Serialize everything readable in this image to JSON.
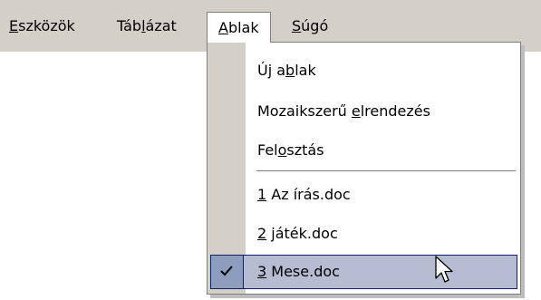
{
  "menubar": {
    "items": [
      {
        "mnemonic": "E",
        "rest": "szközök"
      },
      {
        "pre": "Táb",
        "mnemonic": "l",
        "rest": "ázat"
      },
      {
        "mnemonic": "A",
        "rest": "blak"
      },
      {
        "mnemonic": "S",
        "rest": "úgó"
      }
    ],
    "open_index": 2
  },
  "dropdown": {
    "items": [
      {
        "pre": "Új a",
        "mnemonic": "b",
        "rest": "lak"
      },
      {
        "pre": "Mozaikszerű ",
        "mnemonic": "e",
        "rest": "lrendezés"
      },
      {
        "pre": "Fel",
        "mnemonic": "o",
        "rest": "sztás"
      },
      {
        "pre": "",
        "mnemonic": "1",
        "rest": " Az írás.doc"
      },
      {
        "pre": "",
        "mnemonic": "2",
        "rest": " játék.doc"
      },
      {
        "pre": "",
        "mnemonic": "3",
        "rest": " Mese.doc",
        "checked": true,
        "highlighted": true
      }
    ]
  },
  "colors": {
    "menubar_bg": "#d4d0c8",
    "highlight_bg": "#b6bdd2",
    "highlight_border": "#0a246a"
  },
  "icons": {
    "check": "check-icon",
    "cursor": "arrow-cursor-icon"
  }
}
